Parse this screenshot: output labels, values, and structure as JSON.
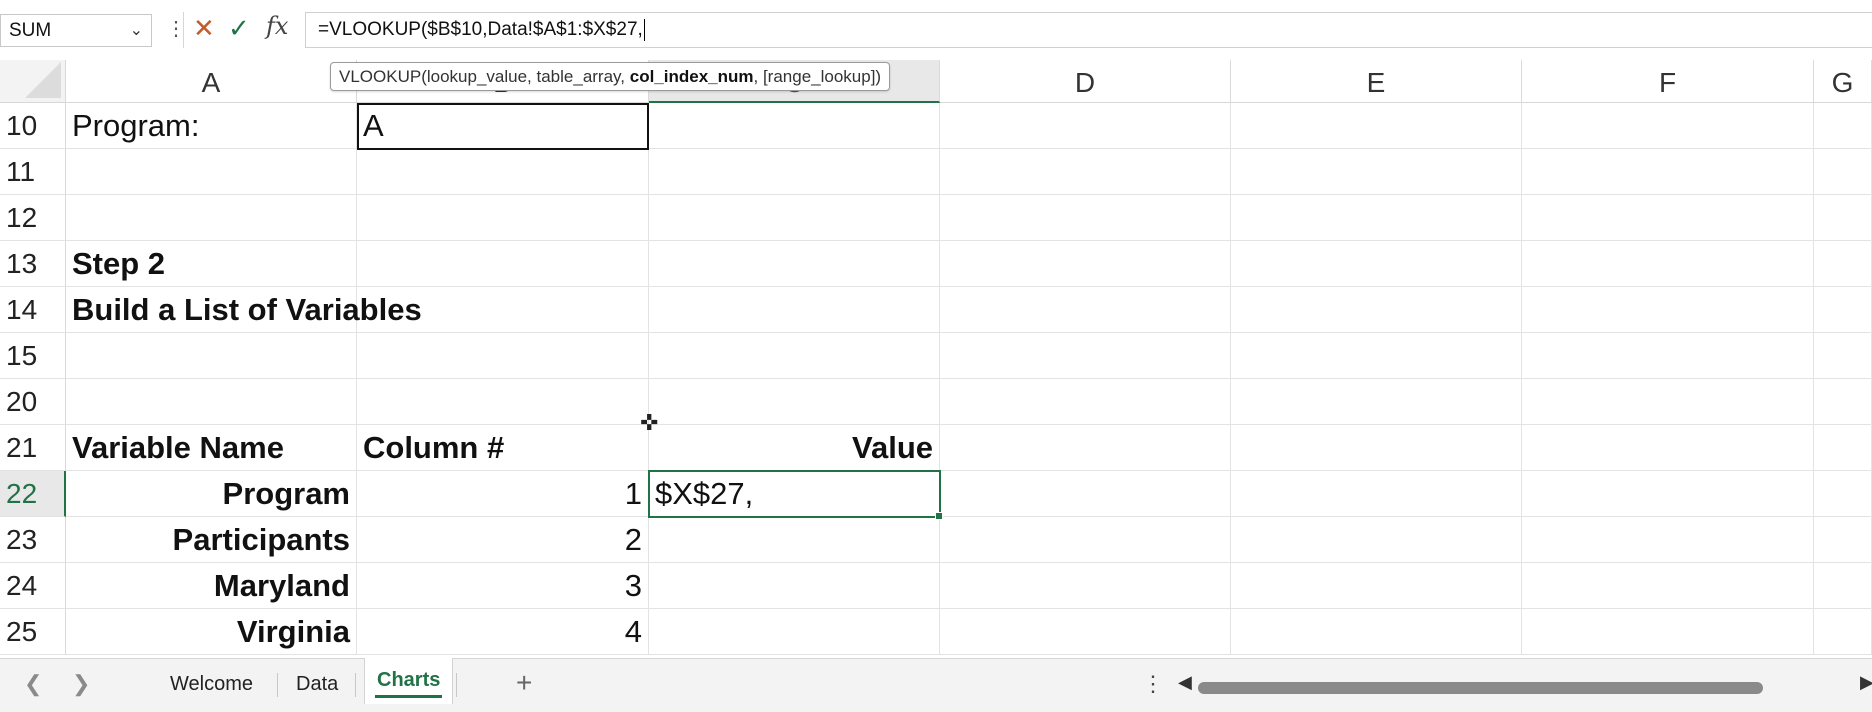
{
  "formula_bar": {
    "name_box": "SUM",
    "formula": "=VLOOKUP($B$10,Data!$A$1:$X$27,"
  },
  "tooltip": {
    "func": "VLOOKUP(",
    "arg1": "lookup_value, ",
    "arg2": "table_array, ",
    "arg_current": "col_index_num",
    "rest": ", [range_lookup])"
  },
  "columns": [
    "A",
    "B",
    "C",
    "D",
    "E",
    "F",
    "G"
  ],
  "rows": [
    "10",
    "11",
    "12",
    "13",
    "14",
    "15",
    "20",
    "21",
    "22",
    "23",
    "24",
    "25"
  ],
  "cells": {
    "program_label": "Program:",
    "program_value": "A",
    "step_title": "Step 2",
    "step_subtitle": "Build a List of Variables",
    "header_variable": "Variable Name",
    "header_column": "Column #",
    "header_value": "Value",
    "editing_value": "$X$27,",
    "variables": [
      {
        "name": "Program",
        "column": "1"
      },
      {
        "name": "Participants",
        "column": "2"
      },
      {
        "name": "Maryland",
        "column": "3"
      },
      {
        "name": "Virginia",
        "column": "4"
      }
    ]
  },
  "sheets": {
    "tabs": [
      "Welcome",
      "Data",
      "Charts"
    ],
    "active": "Charts"
  },
  "colors": {
    "accent": "#217346",
    "cancel": "#c55a2c"
  }
}
